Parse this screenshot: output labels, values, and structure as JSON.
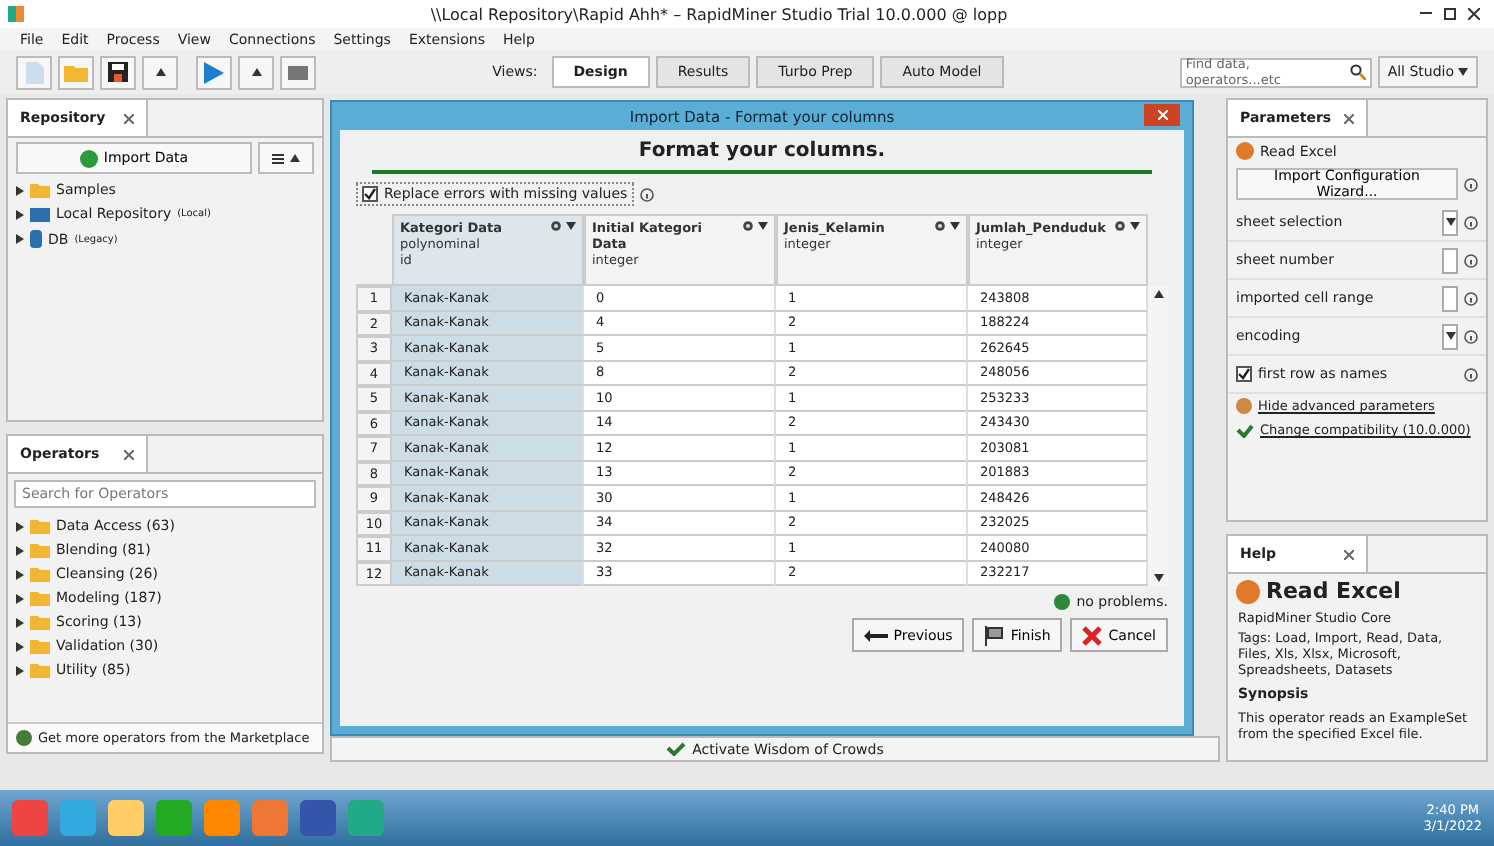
{
  "window": {
    "title": "\\\\Local Repository\\Rapid Ahh* – RapidMiner Studio Trial 10.0.000 @ lopp"
  },
  "menu": [
    "File",
    "Edit",
    "Process",
    "View",
    "Connections",
    "Settings",
    "Extensions",
    "Help"
  ],
  "toolbar": {
    "views_label": "Views:",
    "views": [
      {
        "label": "Design",
        "selected": true
      },
      {
        "label": "Results",
        "selected": false
      },
      {
        "label": "Turbo Prep",
        "selected": false
      },
      {
        "label": "Auto Model",
        "selected": false
      }
    ],
    "search": {
      "placeholder": "Find data, operators...etc"
    },
    "scope": "All Studio"
  },
  "repository": {
    "tab": "Repository",
    "import_button": "Import Data",
    "items": [
      {
        "label": "Samples",
        "kind": "folder"
      },
      {
        "label": "Local Repository",
        "note": "(Local)",
        "kind": "repo"
      },
      {
        "label": "DB",
        "note": "(Legacy)",
        "kind": "db"
      }
    ]
  },
  "operators": {
    "tab": "Operators",
    "search": {
      "placeholder": "Search for Operators"
    },
    "items": [
      "Data Access (63)",
      "Blending (81)",
      "Cleansing (26)",
      "Modeling (187)",
      "Scoring (13)",
      "Validation (30)",
      "Utility (85)"
    ],
    "marketplace": "Get more operators from the Marketplace"
  },
  "background_bar": "Activate Wisdom of Crowds",
  "dialog": {
    "title": "Import Data - Format your columns",
    "heading": "Format your columns.",
    "replace_errors": {
      "label": "Replace errors with missing values",
      "checked": true
    },
    "table": {
      "columns": [
        {
          "name": "Kategori Data",
          "type": "polynominal",
          "role": "id",
          "selected": true
        },
        {
          "name": "Initial Kategori Data",
          "type": "integer",
          "selected": false
        },
        {
          "name": "Jenis_Kelamin",
          "type": "integer",
          "selected": false
        },
        {
          "name": "Jumlah_Penduduk",
          "type": "integer",
          "selected": false
        }
      ],
      "rows": [
        {
          "index": "1",
          "cells": [
            "Kanak-Kanak",
            "0",
            "1",
            "243808"
          ]
        },
        {
          "index": "2",
          "cells": [
            "Kanak-Kanak",
            "4",
            "2",
            "188224"
          ]
        },
        {
          "index": "3",
          "cells": [
            "Kanak-Kanak",
            "5",
            "1",
            "262645"
          ]
        },
        {
          "index": "4",
          "cells": [
            "Kanak-Kanak",
            "8",
            "2",
            "248056"
          ]
        },
        {
          "index": "5",
          "cells": [
            "Kanak-Kanak",
            "10",
            "1",
            "253233"
          ]
        },
        {
          "index": "6",
          "cells": [
            "Kanak-Kanak",
            "14",
            "2",
            "243430"
          ]
        },
        {
          "index": "7",
          "cells": [
            "Kanak-Kanak",
            "12",
            "1",
            "203081"
          ]
        },
        {
          "index": "8",
          "cells": [
            "Kanak-Kanak",
            "13",
            "2",
            "201883"
          ]
        },
        {
          "index": "9",
          "cells": [
            "Kanak-Kanak",
            "30",
            "1",
            "248426"
          ]
        },
        {
          "index": "10",
          "cells": [
            "Kanak-Kanak",
            "34",
            "2",
            "232025"
          ]
        },
        {
          "index": "11",
          "cells": [
            "Kanak-Kanak",
            "32",
            "1",
            "240080"
          ]
        },
        {
          "index": "12",
          "cells": [
            "Kanak-Kanak",
            "33",
            "2",
            "232217"
          ]
        }
      ]
    },
    "status": "no problems.",
    "buttons": [
      {
        "label": "Previous",
        "kind": "previous"
      },
      {
        "label": "Finish",
        "kind": "finish"
      },
      {
        "label": "Cancel",
        "kind": "cancel"
      }
    ]
  },
  "parameters": {
    "tab": "Parameters",
    "operator": "Read Excel",
    "wizard_button": "Import Configuration Wizard...",
    "params": [
      {
        "label": "sheet selection",
        "kind": "dropdown"
      },
      {
        "label": "sheet number",
        "kind": "field"
      },
      {
        "label": "imported cell range",
        "kind": "field"
      },
      {
        "label": "encoding",
        "kind": "dropdown"
      },
      {
        "label": "first row as names",
        "kind": "checkbox",
        "checked": true
      }
    ],
    "advanced_link": "Hide advanced parameters",
    "compat_link": "Change compatibility (10.0.000)"
  },
  "help": {
    "tab": "Help",
    "title": "Read Excel",
    "subtitle": "RapidMiner Studio Core",
    "tags": "Tags: Load, Import, Read, Data, Files, Xls, Xlsx, Microsoft, Spreadsheets, Datasets",
    "synopsis_label": "Synopsis",
    "synopsis": "This operator reads an ExampleSet from the specified Excel file."
  },
  "taskbar": {
    "time": "2:40 PM",
    "date": "3/1/2022"
  }
}
